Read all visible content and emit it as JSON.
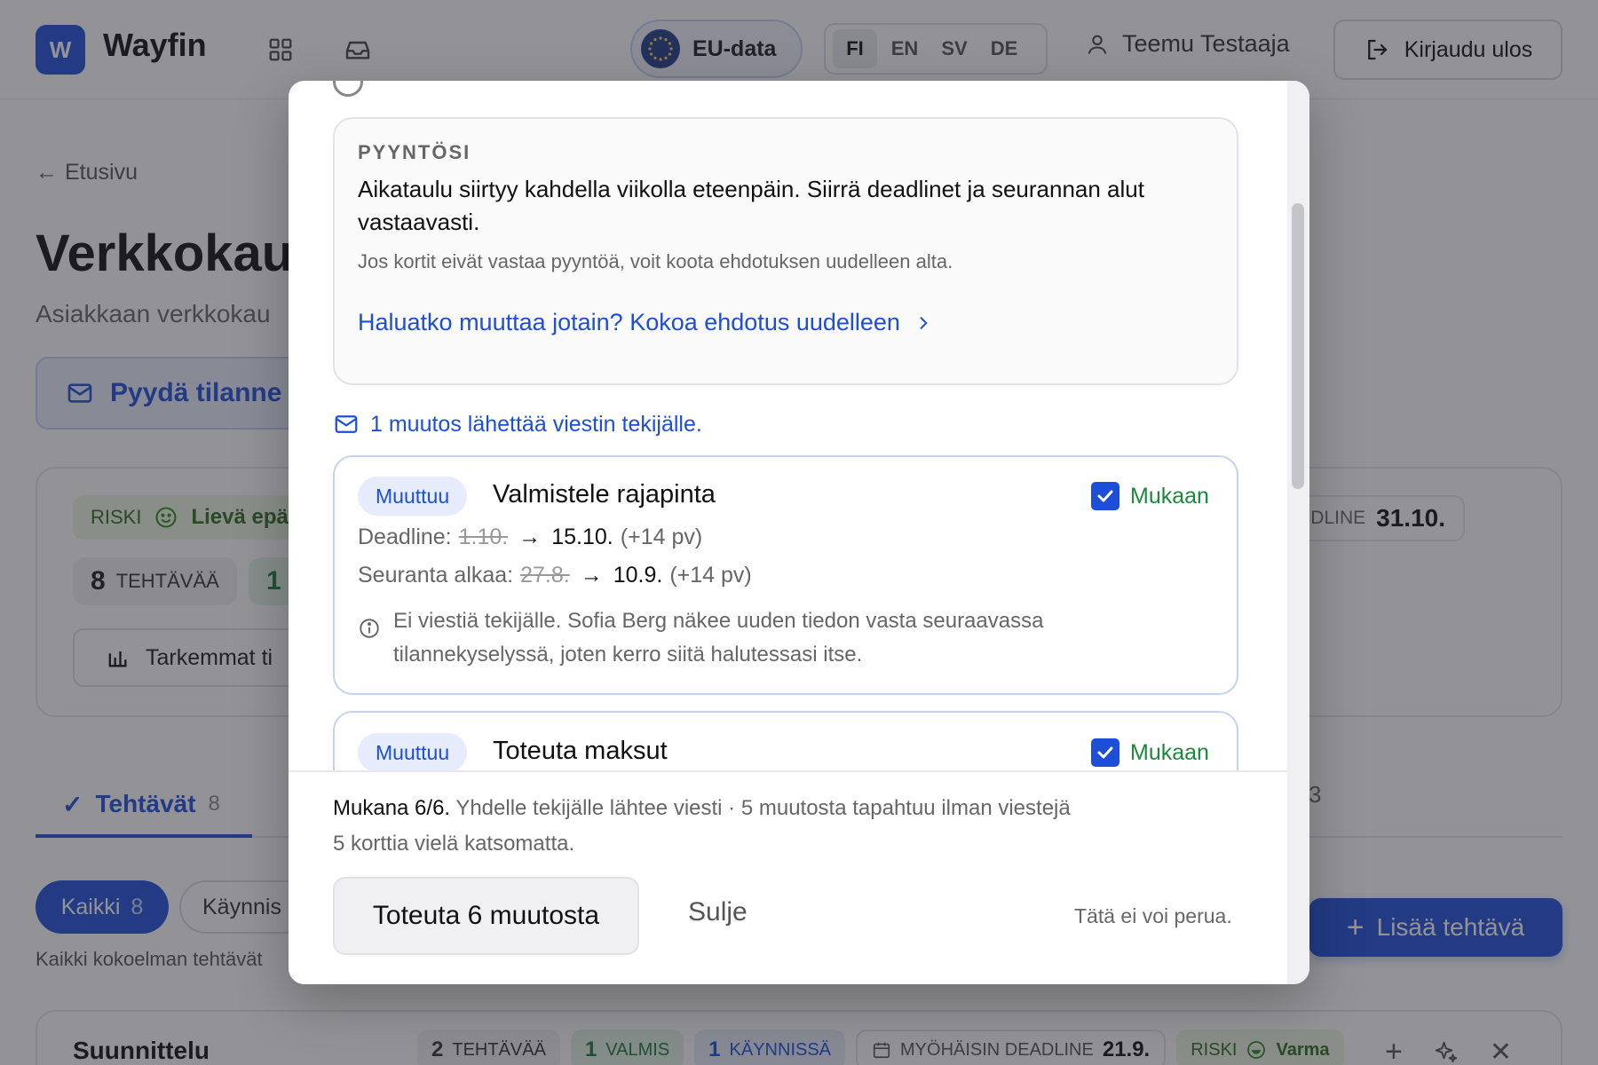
{
  "app": {
    "logo_letter": "W",
    "brand": "Wayfin",
    "eu_badge": "EU-data",
    "languages": [
      "FI",
      "EN",
      "SV",
      "DE"
    ],
    "active_language": "FI",
    "user_name": "Teemu Testaaja",
    "logout_label": "Kirjaudu ulos"
  },
  "page": {
    "back_label": "Etusivu",
    "title": "Verkkokau",
    "subtitle": "Asiakkaan verkkokau",
    "request_button": "Pyydä tilanne",
    "risk_label": "RISKI",
    "risk_value": "Lievä epä",
    "task_count": "8",
    "task_count_label": "TEHTÄVÄÄ",
    "green_count": "1",
    "details_button": "Tarkemmat ti",
    "deadline_label": "DLINE",
    "deadline_value": "31.10.",
    "tab_tasks": "Tehtävät",
    "tab_tasks_count": "8",
    "tab_right_count": "3",
    "filter_all": "Kaikki",
    "filter_all_count": "8",
    "filter_running": "Käynnis",
    "filter_desc": "Kaikki kokoelman tehtävät",
    "add_task": "Lisää tehtävä",
    "group": {
      "title": "Suunnittelu",
      "count": "2",
      "count_label": "TEHTÄVÄÄ",
      "done": "1",
      "done_label": "VALMIS",
      "running": "1",
      "running_label": "KÄYNNISSÄ",
      "deadline_label": "MYÖHÄISIN DEADLINE",
      "deadline_value": "21.9.",
      "risk_label": "RISKI",
      "risk_value": "Varma"
    }
  },
  "modal": {
    "request": {
      "label": "PYYNTÖSI",
      "text": "Aikataulu siirtyy kahdella viikolla eteenpäin. Siirrä deadlinet ja seurannan alut vastaavasti.",
      "hint": "Jos kortit eivät vastaa pyyntöä, voit koota ehdotuksen uudelleen alta.",
      "link": "Haluatko muuttaa jotain? Kokoa ehdotus uudelleen"
    },
    "notice": "1 muutos lähettää viestin tekijälle.",
    "changes": [
      {
        "badge": "Muuttuu",
        "title": "Valmistele rajapinta",
        "include_label": "Mukaan",
        "deadline_label": "Deadline:",
        "deadline_old": "1.10.",
        "deadline_new": "15.10.",
        "deadline_delta": "(+14 pv)",
        "follow_label": "Seuranta alkaa:",
        "follow_old": "27.8.",
        "follow_new": "10.9.",
        "follow_delta": "(+14 pv)",
        "note": "Ei viestiä tekijälle. Sofia Berg näkee uuden tiedon vasta seuraavassa tilannekyselyssä, joten kerro siitä halutessasi itse."
      },
      {
        "badge": "Muuttuu",
        "title": "Toteuta maksut",
        "include_label": "Mukaan"
      }
    ],
    "footer": {
      "included": "Mukana 6/6.",
      "summary": "Yhdelle tekijälle lähtee viesti · 5 muutosta tapahtuu ilman viestejä",
      "pending": "5 korttia vielä katsomatta.",
      "apply_button": "Toteuta 6 muutosta",
      "close_button": "Sulje",
      "irreversible": "Tätä ei voi perua."
    }
  }
}
